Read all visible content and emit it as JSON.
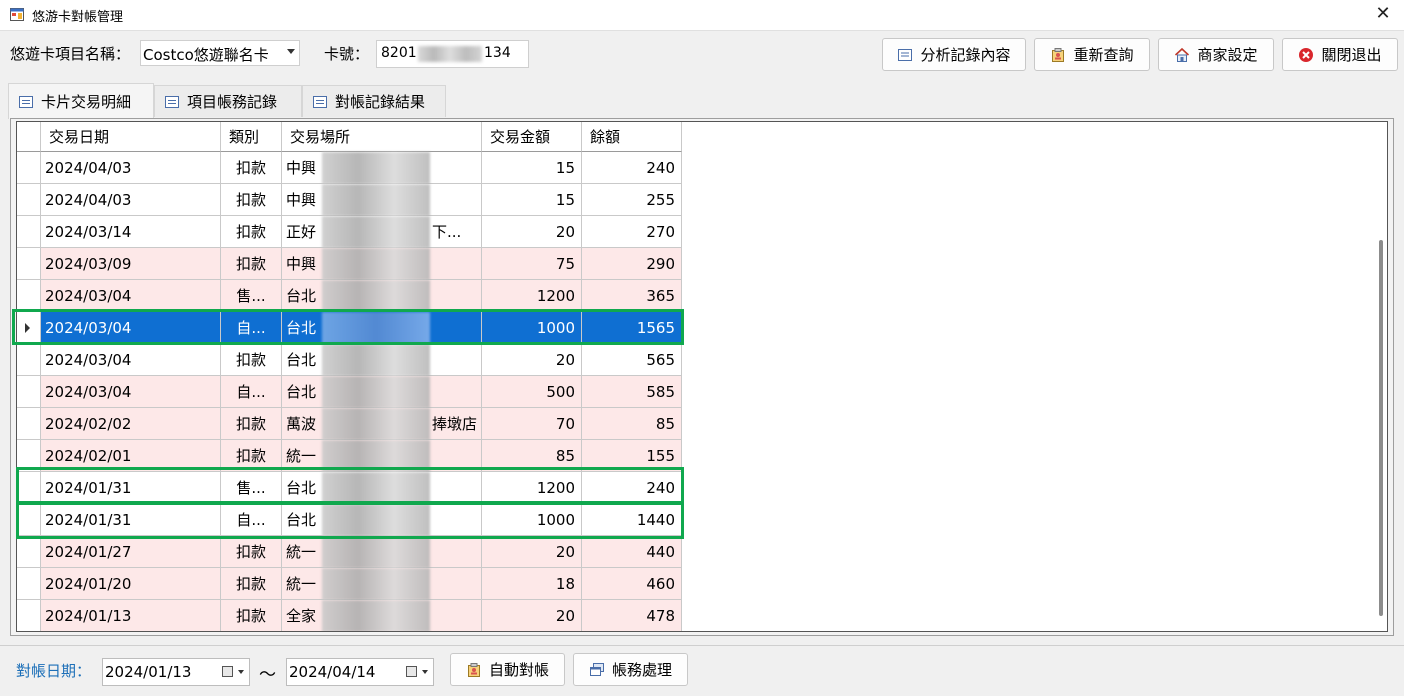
{
  "window": {
    "title": "悠游卡對帳管理"
  },
  "topbar": {
    "project_label": "悠遊卡項目名稱：",
    "project_value": "Costco悠遊聯名卡",
    "card_label": "卡號：",
    "card_prefix": "8201",
    "card_suffix": "134",
    "buttons": {
      "analyze": "分析記錄內容",
      "requery": "重新查詢",
      "merchant": "商家設定",
      "close": "關閉退出"
    }
  },
  "tabs": [
    "卡片交易明細",
    "項目帳務記錄",
    "對帳記錄結果"
  ],
  "grid": {
    "headers": [
      "交易日期",
      "類別",
      "交易場所",
      "交易金額",
      "餘額"
    ],
    "rows": [
      {
        "date": "2024/04/03",
        "type": "扣款",
        "place": "中興",
        "amount": "15",
        "balance": "240",
        "bg": "white"
      },
      {
        "date": "2024/04/03",
        "type": "扣款",
        "place": "中興",
        "amount": "15",
        "balance": "255",
        "bg": "white"
      },
      {
        "date": "2024/03/14",
        "type": "扣款",
        "place": "正好",
        "amount": "20",
        "balance": "270",
        "bg": "white",
        "tail": "下..."
      },
      {
        "date": "2024/03/09",
        "type": "扣款",
        "place": "中興",
        "amount": "75",
        "balance": "290",
        "bg": "pink"
      },
      {
        "date": "2024/03/04",
        "type": "售...",
        "place": "台北",
        "amount": "1200",
        "balance": "365",
        "bg": "pink"
      },
      {
        "date": "2024/03/04",
        "type": "自...",
        "place": "台北",
        "amount": "1000",
        "balance": "1565",
        "bg": "sel"
      },
      {
        "date": "2024/03/04",
        "type": "扣款",
        "place": "台北",
        "amount": "20",
        "balance": "565",
        "bg": "white"
      },
      {
        "date": "2024/03/04",
        "type": "自...",
        "place": "台北",
        "amount": "500",
        "balance": "585",
        "bg": "pink"
      },
      {
        "date": "2024/02/02",
        "type": "扣款",
        "place": "萬波",
        "amount": "70",
        "balance": "85",
        "bg": "pink",
        "tail": "捧墩店"
      },
      {
        "date": "2024/02/01",
        "type": "扣款",
        "place": "統一",
        "amount": "85",
        "balance": "155",
        "bg": "pink"
      },
      {
        "date": "2024/01/31",
        "type": "售...",
        "place": "台北",
        "amount": "1200",
        "balance": "240",
        "bg": "white"
      },
      {
        "date": "2024/01/31",
        "type": "自...",
        "place": "台北",
        "amount": "1000",
        "balance": "1440",
        "bg": "white"
      },
      {
        "date": "2024/01/27",
        "type": "扣款",
        "place": "統一",
        "amount": "20",
        "balance": "440",
        "bg": "pink"
      },
      {
        "date": "2024/01/20",
        "type": "扣款",
        "place": "統一",
        "amount": "18",
        "balance": "460",
        "bg": "pink"
      },
      {
        "date": "2024/01/13",
        "type": "扣款",
        "place": "全家",
        "amount": "20",
        "balance": "478",
        "bg": "pink"
      }
    ]
  },
  "bottom": {
    "date_label": "對帳日期：",
    "date_from": "2024/01/13",
    "separator": "～",
    "date_to": "2024/04/14",
    "auto_reconcile": "自動對帳",
    "accounting": "帳務處理"
  },
  "colors": {
    "selection": "#0f6fd2",
    "pink_row": "#fde8e8",
    "highlight": "#10a84e",
    "date_label": "#1c6fb8"
  }
}
